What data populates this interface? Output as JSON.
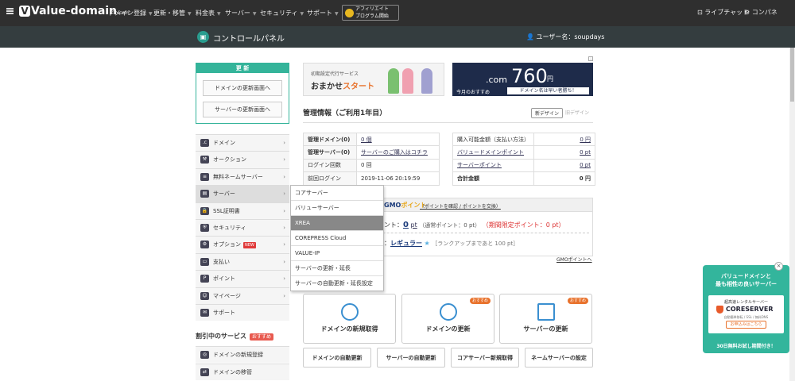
{
  "topnav": {
    "logo_text": "Value-domain",
    "logo_suffix": ".com",
    "menu": [
      "ドメイン登録",
      "更新・移管",
      "料金表",
      "サーバー",
      "セキュリティ",
      "サポート"
    ],
    "affiliate_line1": "アフィリエイト",
    "affiliate_line2": "プログラム開始",
    "live_chat": "ライブチャット",
    "control_panel": "コンパネ"
  },
  "subbar": {
    "title": "コントロールパネル",
    "user_label": "ユーザー名：soupdays"
  },
  "update_box": {
    "title": "更 新",
    "domain_btn": "ドメインの更新画面へ",
    "server_btn": "サーバーの更新画面へ"
  },
  "side_menu": [
    {
      "label": "ドメイン",
      "icon": "com"
    },
    {
      "label": "オークション",
      "icon": "auction"
    },
    {
      "label": "無料ネームサーバー",
      "icon": "list"
    },
    {
      "label": "サーバー",
      "icon": "server"
    },
    {
      "label": "SSL証明書",
      "icon": "ssl"
    },
    {
      "label": "セキュリティ",
      "icon": "security"
    },
    {
      "label": "オプション",
      "icon": "option",
      "badge": "NEW"
    },
    {
      "label": "支払い",
      "icon": "payment"
    },
    {
      "label": "ポイント",
      "icon": "point"
    },
    {
      "label": "マイページ",
      "icon": "mypage"
    },
    {
      "label": "サポート",
      "icon": "support"
    }
  ],
  "discount": {
    "title": "割引中のサービス",
    "badge": "おすすめ",
    "items": [
      "ドメインの新規登録",
      "ドメインの移管"
    ]
  },
  "server_dropdown": [
    "コアサーバー",
    "バリューサーバー",
    "XREA",
    "COREPRESS Cloud",
    "VALUE-IP",
    "サーバーの更新・延長",
    "サーバーの自動更新・延長設定"
  ],
  "banner1": {
    "small": "初期設定代行サービス",
    "large_a": "おまかせ",
    "large_b": "スタート"
  },
  "banner2": {
    "domain": ".com",
    "price": "760",
    "yen": "円",
    "sub1": "今月のおすすめ",
    "sub2": "ドメイン名は早い者勝ち！"
  },
  "management": {
    "title": "管理情報（ご利用1年目）",
    "new_design": "新デザイン",
    "old_design": "旧デザイン",
    "left": [
      {
        "key": "管理ドメイン(0)",
        "value": "0 個"
      },
      {
        "key": "管理サーバー(0)",
        "value": "サーバーのご購入はコチラ"
      },
      {
        "key": "ログイン回数",
        "value": "0 回"
      },
      {
        "key": "前回ログイン",
        "value": "2019-11-06 20:19:59"
      }
    ],
    "right": [
      {
        "key": "購入可能金額（支払い方法）",
        "value": "0 円"
      },
      {
        "key": "バリュードメインポイント",
        "value": "0 pt"
      },
      {
        "key": "サーバーポイント",
        "value": "0 pt"
      },
      {
        "key": "合計金額",
        "value": "0 円"
      }
    ]
  },
  "gmo": {
    "logo_a": "GMO",
    "logo_b": "ポイント",
    "links": "（ポイントを確認 / ポイントを交換）",
    "points_label": "ント：",
    "points_value": "0",
    "points_unit": "pt",
    "normal_points": "（通常ポイント：0 pt）",
    "limited_points": "（期間限定ポイント：0 pt）",
    "rank_label": "：",
    "rank": "レギュラー",
    "rank_next": "［ランクアップまであと 100 pt］",
    "more": "GMOポイントへ"
  },
  "cards": [
    {
      "label": "ドメインの新規取得",
      "tag": ""
    },
    {
      "label": "ドメインの更新",
      "tag": "おすすめ"
    },
    {
      "label": "サーバーの更新",
      "tag": "おすすめ"
    }
  ],
  "buttons": [
    "ドメインの自動更新",
    "サーバーの自動更新",
    "コアサーバー新規取得",
    "ネームサーバーの設定"
  ],
  "promo": {
    "title_1": "バリュードメインと",
    "title_2": "最も相性の良いサーバー",
    "inner_top": "超高速レンタルサーバー",
    "brand": "CORESERVER",
    "inner_sub": "自動簡単移転 / SSL / 無料DNS",
    "apply": "お申込みはこちら",
    "footer": "30日無料お試し期間付き！",
    "close": "×"
  },
  "ad_marker": "i"
}
